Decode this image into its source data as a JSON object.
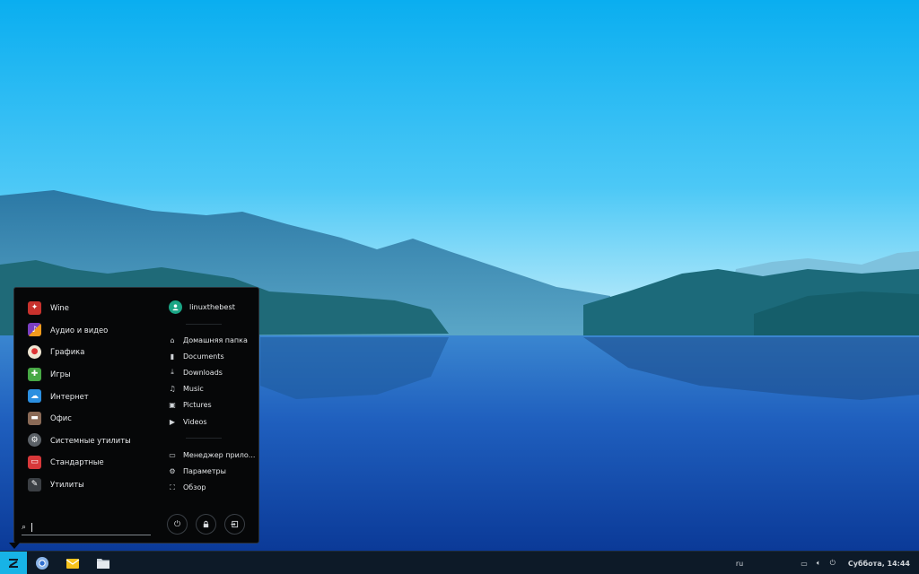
{
  "menu": {
    "categories": [
      {
        "label": "Wine",
        "icon": "wine-icon",
        "color": "#c8322d"
      },
      {
        "label": "Аудио и видео",
        "icon": "media-icon",
        "color": "#f29a1c"
      },
      {
        "label": "Графика",
        "icon": "palette-icon",
        "color": "#efe6d2"
      },
      {
        "label": "Игры",
        "icon": "gamepad-icon",
        "color": "#47a845"
      },
      {
        "label": "Интернет",
        "icon": "cloud-icon",
        "color": "#2b8fe0"
      },
      {
        "label": "Офис",
        "icon": "briefcase-icon",
        "color": "#8a6a56"
      },
      {
        "label": "Системные утилиты",
        "icon": "gear-icon",
        "color": "#5b6167"
      },
      {
        "label": "Стандартные",
        "icon": "toolbox-icon",
        "color": "#d7383a"
      },
      {
        "label": "Утилиты",
        "icon": "utilities-icon",
        "color": "#3b3f44"
      }
    ],
    "user": {
      "name": "linuxthebest"
    },
    "places": [
      {
        "label": "Домашняя папка",
        "icon": "home-icon"
      },
      {
        "label": "Documents",
        "icon": "document-icon"
      },
      {
        "label": "Downloads",
        "icon": "download-icon"
      },
      {
        "label": "Music",
        "icon": "music-icon"
      },
      {
        "label": "Pictures",
        "icon": "image-icon"
      },
      {
        "label": "Videos",
        "icon": "video-icon"
      }
    ],
    "system": [
      {
        "label": "Менеджер прило...",
        "icon": "app-manager-icon"
      },
      {
        "label": "Параметры",
        "icon": "settings-icon"
      },
      {
        "label": "Обзор",
        "icon": "overview-icon"
      }
    ],
    "search": {
      "value": ""
    }
  },
  "taskbar": {
    "apps": [
      {
        "name": "chromium-icon"
      },
      {
        "name": "mail-icon"
      },
      {
        "name": "files-icon"
      }
    ],
    "tray": {
      "language": "ru",
      "clock": "Суббота, 14:44"
    }
  },
  "colors": {
    "accent": "#17b3e6",
    "menu_bg": "#060708",
    "taskbar_bg": "#0d1a28"
  }
}
